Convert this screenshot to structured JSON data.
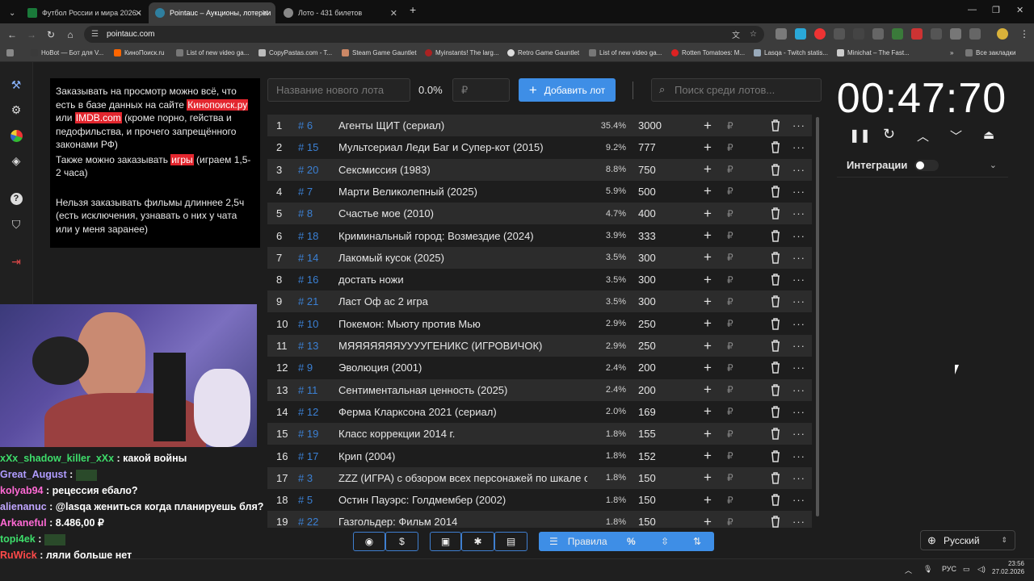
{
  "browser": {
    "tabs": [
      {
        "label": "Футбол России и мира 2026 -",
        "color": "#1a7a3a"
      },
      {
        "label": "Pointauc – Аукционы, лотереи",
        "color": "#2f7f9f"
      },
      {
        "label": "Лото - 431 билетов",
        "color": "#888888"
      }
    ],
    "url": "pointauc.com",
    "bookmarks": [
      "HoBot — Бот для V...",
      "КиноПоиск.ru",
      "List of new video ga...",
      "CopyPastas.com - T...",
      "Steam Game Gauntlet",
      "Myinstants! The larg...",
      "Retro Game Gauntlet",
      "List of new video ga...",
      "Rotten Tomatoes: M...",
      "Lasqa - Twitch statis...",
      "Minichat – The Fast..."
    ],
    "all_bookmarks": "Все закладки"
  },
  "rules": {
    "p1_a": "Заказывать на просмотр можно всё, что есть в базе данных на сайте ",
    "link1": "Кинопоиск.ру",
    "p1_b": " или ",
    "link2": "IMDB.com",
    "p1_c": " (кроме порно, гейства и педофильства, и прочего запрещённого законами РФ)",
    "p2_a": "Также можно заказывать ",
    "link3": "игры",
    "p2_b": " (играем 1,5-2 часа)",
    "p3": "Нельзя заказывать фильмы длиннее 2,5ч (есть исключения, узнавать о них у чата или у меня заранее)"
  },
  "controls": {
    "new_lot_placeholder": "Название нового лота",
    "percent": "0.0%",
    "amount_placeholder": "₽",
    "add_button": "Добавить лот",
    "search_placeholder": "Поиск среди лотов..."
  },
  "lots": [
    {
      "n": "1",
      "id": "# 6",
      "name": "Агенты ЩИТ (сериал)",
      "pct": "35.4%",
      "amount": "3000"
    },
    {
      "n": "2",
      "id": "# 15",
      "name": "Мультсериал Леди Баг и Супер-кот (2015)",
      "pct": "9.2%",
      "amount": "777"
    },
    {
      "n": "3",
      "id": "# 20",
      "name": "Сексмиссия (1983)",
      "pct": "8.8%",
      "amount": "750"
    },
    {
      "n": "4",
      "id": "# 7",
      "name": "Марти Великолепный (2025)",
      "pct": "5.9%",
      "amount": "500"
    },
    {
      "n": "5",
      "id": "# 8",
      "name": "Счастье мое (2010)",
      "pct": "4.7%",
      "amount": "400"
    },
    {
      "n": "6",
      "id": "# 18",
      "name": "Криминальный город: Возмездие (2024)",
      "pct": "3.9%",
      "amount": "333"
    },
    {
      "n": "7",
      "id": "# 14",
      "name": "Лакомый кусок (2025)",
      "pct": "3.5%",
      "amount": "300"
    },
    {
      "n": "8",
      "id": "# 16",
      "name": "достать ножи",
      "pct": "3.5%",
      "amount": "300"
    },
    {
      "n": "9",
      "id": "# 21",
      "name": "Ласт Оф ас 2 игра",
      "pct": "3.5%",
      "amount": "300"
    },
    {
      "n": "10",
      "id": "# 10",
      "name": "Покемон: Мьюту против Мью",
      "pct": "2.9%",
      "amount": "250"
    },
    {
      "n": "11",
      "id": "# 13",
      "name": "МЯЯЯЯЯЯЯУУУУГЕНИКС (ИГРОВИЧОК)",
      "pct": "2.9%",
      "amount": "250"
    },
    {
      "n": "12",
      "id": "# 9",
      "name": "Эволюция (2001)",
      "pct": "2.4%",
      "amount": "200"
    },
    {
      "n": "13",
      "id": "# 11",
      "name": "Сентиментальная ценность (2025)",
      "pct": "2.4%",
      "amount": "200"
    },
    {
      "n": "14",
      "id": "# 12",
      "name": "Ферма Кларксона 2021 (сериал)",
      "pct": "2.0%",
      "amount": "169"
    },
    {
      "n": "15",
      "id": "# 19",
      "name": "Класс коррекции 2014 г.",
      "pct": "1.8%",
      "amount": "155"
    },
    {
      "n": "16",
      "id": "# 17",
      "name": "Крип (2004)",
      "pct": "1.8%",
      "amount": "152"
    },
    {
      "n": "17",
      "id": "# 3",
      "name": "ZZZ (ИГРА) с обзором всех персонажей по шкале от",
      "pct": "1.8%",
      "amount": "150"
    },
    {
      "n": "18",
      "id": "# 5",
      "name": "Остин Пауэрс: Голдмембер (2002)",
      "pct": "1.8%",
      "amount": "150"
    },
    {
      "n": "19",
      "id": "# 22",
      "name": "Газгольдер: Фильм 2014",
      "pct": "1.8%",
      "amount": "150"
    }
  ],
  "currency": "₽",
  "timer": {
    "value": "00:47:70"
  },
  "integrations": {
    "label": "Интеграции"
  },
  "toolbar": {
    "rules_label": "Правила",
    "percent_label": "%"
  },
  "language": {
    "value": "Русский"
  },
  "chat": [
    {
      "user": "xXx_shadow_killer_xXx",
      "sep": " : ",
      "text": "какой войны",
      "color": "#3ddc6a"
    },
    {
      "user": "Great_August",
      "sep": " : ",
      "text": "",
      "color": "#b09cff"
    },
    {
      "user": "kolyab94",
      "sep": " : ",
      "text": "рецессия ебало?",
      "color": "#ff6ad5"
    },
    {
      "user": "alienanuc",
      "sep": " : ",
      "text": "@lasqa жениться когда планируешь бля?",
      "color": "#c0a6ff"
    },
    {
      "user": "Arkaneful",
      "sep": " : ",
      "text": "8.486,00 ₽",
      "color": "#ff6ad5"
    },
    {
      "user": "topi4ek",
      "sep": " : ",
      "text": "",
      "color": "#3ddc6a"
    },
    {
      "user": "RuWick",
      "sep": " : ",
      "text": "ляли больше нет",
      "color": "#ff4a4a"
    }
  ],
  "taskbar": {
    "lang": "РУС",
    "time": "23:56",
    "date": "27.02.2026"
  }
}
